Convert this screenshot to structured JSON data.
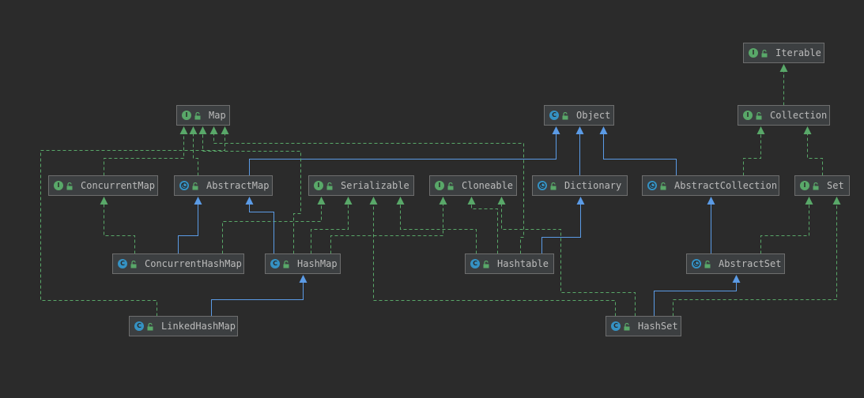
{
  "colors": {
    "background": "#2b2b2b",
    "node_fill": "#3c3f41",
    "node_border": "#6e6e6e",
    "text": "#bbbbbb",
    "interface_badge": "#59a869",
    "class_badge": "#3592c4",
    "implements_edge": "#59a869",
    "extends_edge": "#5b9be6"
  },
  "icons": {
    "interface": "interface-icon",
    "class": "class-icon",
    "abstract_class": "abstract-class-icon",
    "visibility": "unlocked-icon"
  },
  "nodes": [
    {
      "id": "Iterable",
      "label": "Iterable",
      "kind": "interface",
      "badge": "I"
    },
    {
      "id": "Map",
      "label": "Map",
      "kind": "interface",
      "badge": "I"
    },
    {
      "id": "Object",
      "label": "Object",
      "kind": "class",
      "badge": "C"
    },
    {
      "id": "Collection",
      "label": "Collection",
      "kind": "interface",
      "badge": "I"
    },
    {
      "id": "ConcurrentMap",
      "label": "ConcurrentMap",
      "kind": "interface",
      "badge": "I"
    },
    {
      "id": "AbstractMap",
      "label": "AbstractMap",
      "kind": "abstract",
      "badge": "C"
    },
    {
      "id": "Serializable",
      "label": "Serializable",
      "kind": "interface",
      "badge": "I"
    },
    {
      "id": "Cloneable",
      "label": "Cloneable",
      "kind": "interface",
      "badge": "I"
    },
    {
      "id": "Dictionary",
      "label": "Dictionary",
      "kind": "abstract",
      "badge": "C"
    },
    {
      "id": "AbstractCollection",
      "label": "AbstractCollection",
      "kind": "abstract",
      "badge": "C"
    },
    {
      "id": "Set",
      "label": "Set",
      "kind": "interface",
      "badge": "I"
    },
    {
      "id": "ConcurrentHashMap",
      "label": "ConcurrentHashMap",
      "kind": "class",
      "badge": "C"
    },
    {
      "id": "HashMap",
      "label": "HashMap",
      "kind": "class",
      "badge": "C"
    },
    {
      "id": "Hashtable",
      "label": "Hashtable",
      "kind": "class",
      "badge": "C"
    },
    {
      "id": "AbstractSet",
      "label": "AbstractSet",
      "kind": "abstract",
      "badge": "C"
    },
    {
      "id": "LinkedHashMap",
      "label": "LinkedHashMap",
      "kind": "class",
      "badge": "C"
    },
    {
      "id": "HashSet",
      "label": "HashSet",
      "kind": "class",
      "badge": "C"
    }
  ],
  "edges": [
    {
      "from": "Collection",
      "to": "Iterable",
      "type": "extends-interface"
    },
    {
      "from": "Set",
      "to": "Collection",
      "type": "extends-interface"
    },
    {
      "from": "ConcurrentMap",
      "to": "Map",
      "type": "extends-interface"
    },
    {
      "from": "AbstractMap",
      "to": "Map",
      "type": "implements"
    },
    {
      "from": "AbstractMap",
      "to": "Object",
      "type": "extends"
    },
    {
      "from": "Dictionary",
      "to": "Object",
      "type": "extends"
    },
    {
      "from": "AbstractCollection",
      "to": "Object",
      "type": "extends"
    },
    {
      "from": "AbstractCollection",
      "to": "Collection",
      "type": "implements"
    },
    {
      "from": "ConcurrentHashMap",
      "to": "ConcurrentMap",
      "type": "implements"
    },
    {
      "from": "ConcurrentHashMap",
      "to": "AbstractMap",
      "type": "extends"
    },
    {
      "from": "ConcurrentHashMap",
      "to": "Serializable",
      "type": "implements"
    },
    {
      "from": "HashMap",
      "to": "AbstractMap",
      "type": "extends"
    },
    {
      "from": "HashMap",
      "to": "Map",
      "type": "implements"
    },
    {
      "from": "HashMap",
      "to": "Serializable",
      "type": "implements"
    },
    {
      "from": "HashMap",
      "to": "Cloneable",
      "type": "implements"
    },
    {
      "from": "Hashtable",
      "to": "Dictionary",
      "type": "extends"
    },
    {
      "from": "Hashtable",
      "to": "Map",
      "type": "implements"
    },
    {
      "from": "Hashtable",
      "to": "Serializable",
      "type": "implements"
    },
    {
      "from": "Hashtable",
      "to": "Cloneable",
      "type": "implements"
    },
    {
      "from": "AbstractSet",
      "to": "AbstractCollection",
      "type": "extends"
    },
    {
      "from": "AbstractSet",
      "to": "Set",
      "type": "implements"
    },
    {
      "from": "LinkedHashMap",
      "to": "HashMap",
      "type": "extends"
    },
    {
      "from": "LinkedHashMap",
      "to": "Map",
      "type": "implements"
    },
    {
      "from": "HashSet",
      "to": "AbstractSet",
      "type": "extends"
    },
    {
      "from": "HashSet",
      "to": "Set",
      "type": "implements"
    },
    {
      "from": "HashSet",
      "to": "Serializable",
      "type": "implements"
    },
    {
      "from": "HashSet",
      "to": "Cloneable",
      "type": "implements"
    }
  ]
}
